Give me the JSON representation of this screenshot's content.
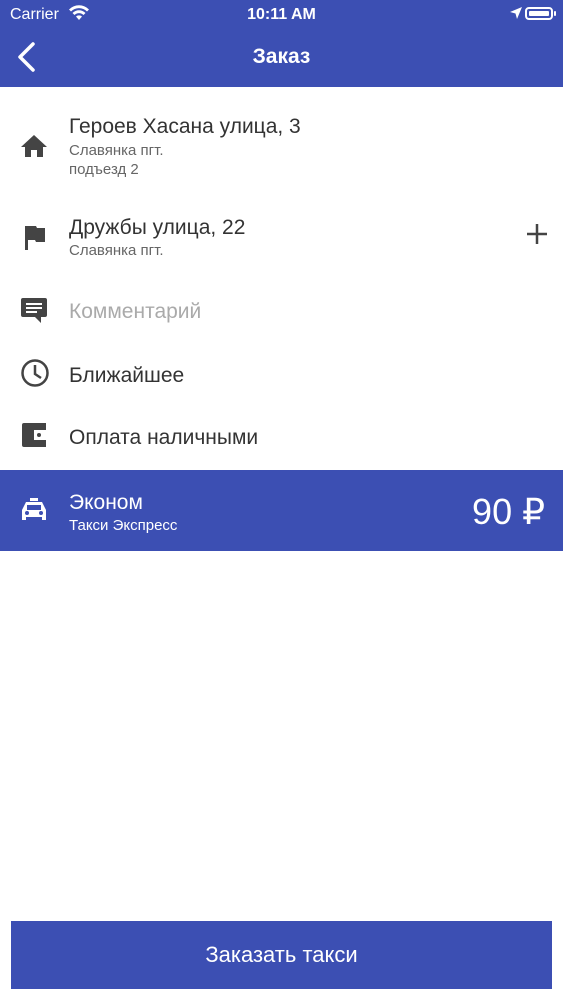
{
  "status_bar": {
    "carrier": "Carrier",
    "time": "10:11 AM"
  },
  "header": {
    "title": "Заказ"
  },
  "route": {
    "from": {
      "street": "Героев Хасана улица, 3",
      "city": "Славянка пгт.",
      "entrance": "подъезд 2"
    },
    "to": {
      "street": "Дружбы улица, 22",
      "city": "Славянка пгт."
    }
  },
  "comment": {
    "placeholder": "Комментарий"
  },
  "time": {
    "label": "Ближайшее"
  },
  "payment": {
    "label": "Оплата наличными"
  },
  "tariff": {
    "name": "Эконом",
    "company": "Такси Экспресс",
    "price": "90 ₽"
  },
  "order_button": {
    "label": "Заказать такси"
  },
  "colors": {
    "primary": "#3c4fb3",
    "icon": "#444444",
    "placeholder": "#aaaaaa"
  }
}
